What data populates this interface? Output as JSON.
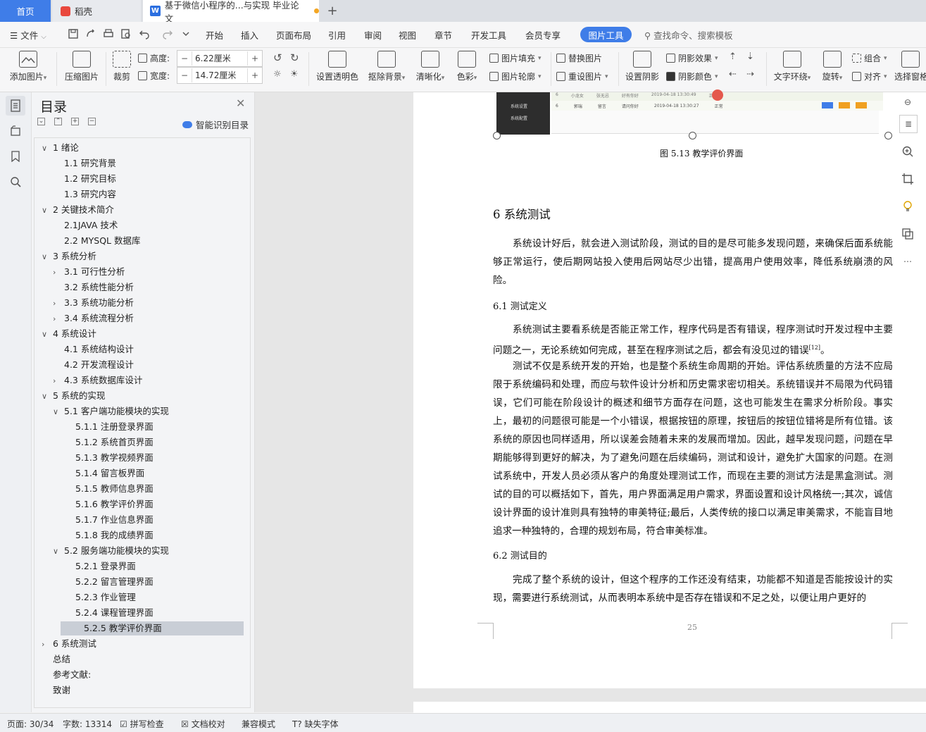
{
  "tabs": {
    "home": "首页",
    "daoke": "稻壳",
    "doc": "基于微信小程序的...与实现 毕业论文",
    "add": "+"
  },
  "menu": {
    "file": "文件",
    "items": [
      "开始",
      "插入",
      "页面布局",
      "引用",
      "审阅",
      "视图",
      "章节",
      "开发工具",
      "会员专享"
    ],
    "active_tool": "图片工具",
    "search": "查找命令、搜索模板"
  },
  "ribbon": {
    "add_image": "添加图片",
    "compress": "压缩图片",
    "crop": "裁剪",
    "height_label": "高度:",
    "height_value": "6.22厘米",
    "width_label": "宽度:",
    "width_value": "14.72厘米",
    "set_transparent": "设置透明色",
    "remove_bg": "抠除背景",
    "sharpen": "清晰化",
    "color": "色彩",
    "image_fill": "图片填充",
    "image_outline": "图片轮廓",
    "replace_image": "替换图片",
    "reset_image": "重设图片",
    "set_shadow": "设置阴影",
    "shadow_effect": "阴影效果",
    "shadow_color": "阴影颜色",
    "text_wrap": "文字环绕",
    "rotate": "旋转",
    "group": "组合",
    "align": "对齐",
    "selection_pane": "选择窗格"
  },
  "toc": {
    "title": "目录",
    "smart_recognize": "智能识别目录",
    "items": [
      {
        "text": "1  绪论",
        "level": 1,
        "arrow": "down"
      },
      {
        "text": "1.1 研究背景",
        "level": 2,
        "arrow": ""
      },
      {
        "text": "1.2 研究目标",
        "level": 2,
        "arrow": ""
      },
      {
        "text": "1.3 研究内容",
        "level": 2,
        "arrow": ""
      },
      {
        "text": "2  关键技术简介",
        "level": 1,
        "arrow": "down"
      },
      {
        "text": "2.1JAVA 技术",
        "level": 2,
        "arrow": ""
      },
      {
        "text": "2.2 MYSQL 数据库",
        "level": 2,
        "arrow": ""
      },
      {
        "text": "3  系统分析",
        "level": 1,
        "arrow": "down"
      },
      {
        "text": "3.1 可行性分析",
        "level": 2,
        "arrow": "right"
      },
      {
        "text": "3.2 系统性能分析",
        "level": 2,
        "arrow": ""
      },
      {
        "text": "3.3 系统功能分析",
        "level": 2,
        "arrow": "right"
      },
      {
        "text": "3.4 系统流程分析",
        "level": 2,
        "arrow": "right"
      },
      {
        "text": "4  系统设计",
        "level": 1,
        "arrow": "down"
      },
      {
        "text": "4.1 系统结构设计",
        "level": 2,
        "arrow": ""
      },
      {
        "text": "4.2 开发流程设计",
        "level": 2,
        "arrow": ""
      },
      {
        "text": "4.3 系统数据库设计",
        "level": 2,
        "arrow": "right"
      },
      {
        "text": "5  系统的实现",
        "level": 1,
        "arrow": "down"
      },
      {
        "text": "5.1 客户端功能模块的实现",
        "level": 2,
        "arrow": "down"
      },
      {
        "text": "5.1.1 注册登录界面",
        "level": 3,
        "arrow": ""
      },
      {
        "text": "5.1.2 系统首页界面",
        "level": 3,
        "arrow": ""
      },
      {
        "text": "5.1.3 教学视频界面",
        "level": 3,
        "arrow": ""
      },
      {
        "text": "5.1.4 留言板界面",
        "level": 3,
        "arrow": ""
      },
      {
        "text": "5.1.5 教师信息界面",
        "level": 3,
        "arrow": ""
      },
      {
        "text": "5.1.6 教学评价界面",
        "level": 3,
        "arrow": ""
      },
      {
        "text": "5.1.7 作业信息界面",
        "level": 3,
        "arrow": ""
      },
      {
        "text": "5.1.8 我的成绩界面",
        "level": 3,
        "arrow": ""
      },
      {
        "text": "5.2 服务端功能模块的实现",
        "level": 2,
        "arrow": "down"
      },
      {
        "text": "5.2.1 登录界面",
        "level": 3,
        "arrow": ""
      },
      {
        "text": "5.2.2 留言管理界面",
        "level": 3,
        "arrow": ""
      },
      {
        "text": "5.2.3 作业管理",
        "level": 3,
        "arrow": ""
      },
      {
        "text": "5.2.4 课程管理界面",
        "level": 3,
        "arrow": ""
      },
      {
        "text": "5.2.5 教学评价界面",
        "level": 3,
        "arrow": "",
        "selected": true
      },
      {
        "text": "6  系统测试",
        "level": 1,
        "arrow": "right"
      },
      {
        "text": "总结",
        "level": 1,
        "arrow": ""
      },
      {
        "text": "参考文献:",
        "level": 1,
        "arrow": ""
      },
      {
        "text": "致谢",
        "level": 1,
        "arrow": ""
      }
    ]
  },
  "doc": {
    "figure_caption": "图 5.13  教学评价界面",
    "heading_6": "6  系统测试",
    "para_intro": "系统设计好后，就会进入测试阶段，测试的目的是尽可能多发现问题，来确保后面系统能够正常运行，使后期网站投入使用后网站尽少出错，提高用户使用效率，降低系统崩溃的风险。",
    "heading_61": "6.1  测试定义",
    "para_61a": "系统测试主要看系统是否能正常工作，程序代码是否有错误，程序测试时开发过程中主要问题之一，无论系统如何完成，甚至在程序测试之后，都会有没见过的错误",
    "para_61a_ref": "[12]",
    "para_61a_end": "。",
    "para_61b": "测试不仅是系统开发的开始，也是整个系统生命周期的开始。评估系统质量的方法不应局限于系统编码和处理，而应与软件设计分析和历史需求密切相关。系统错误并不局限为代码错误，它们可能在阶段设计的概述和细节方面存在问题，这也可能发生在需求分析阶段。事实上，最初的问题很可能是一个小错误，根据按钮的原理，按钮后的按钮位错将是所有位错。该系统的原因也同样适用，所以误差会随着未来的发展而增加。因此，越早发现问题，问题在早期能够得到更好的解决，为了避免问题在后续编码，测试和设计，避免扩大国家的问题。在测试系统中，开发人员必须从客户的角度处理测试工作，而现在主要的测试方法是黑盒测试。测试的目的可以概括如下，首先，用户界面满足用户需求，界面设置和设计风格统一;其次，诚信设计界面的设计准则具有独特的审美特征;最后，人类传统的接口以满足审美需求，不能盲目地追求一种独特的，合理的规划布局，符合审美标准。",
    "heading_62": "6.2  测试目的",
    "para_62": "完成了整个系统的设计，但这个程序的工作还没有结束，功能都不知道是否能按设计的实现，需要进行系统测试，从而表明本系统中是否存在错误和不足之处，以便让用户更好的",
    "page_number": "25",
    "embedded": {
      "side": [
        "系统设置",
        "系统配置"
      ],
      "row1": [
        "6",
        "郭瑞",
        "留言",
        "请问你好",
        "2019-04-18 13:30:27",
        "正常"
      ],
      "row0": [
        "6",
        "小龙女",
        "张无忌",
        "好有你好",
        "2019-04-18 13:30:49",
        "正常"
      ]
    }
  },
  "status": {
    "page": "页面: 30/34",
    "words": "字数: 13314",
    "spell": "拼写检查",
    "proof": "文档校对",
    "compat": "兼容模式",
    "missing_font": "缺失字体"
  },
  "colors": {
    "accent": "#3f7de8",
    "selected_toc": "#c9ced6"
  }
}
